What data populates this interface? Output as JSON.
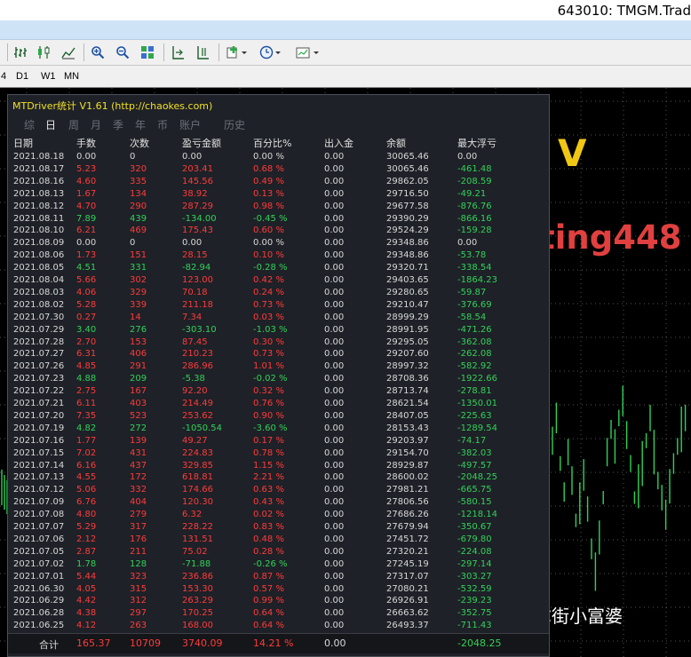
{
  "window": {
    "account_title": "643010: TMGM.Trad"
  },
  "timeframes": [
    "4",
    "D1",
    "W1",
    "MN"
  ],
  "toolbar": {
    "icons": [
      "bar-chart-icon",
      "candle-chart-icon",
      "line-chart-icon",
      "zoom-in-icon",
      "zoom-out-icon",
      "tile-windows-icon",
      "auto-scroll-icon",
      "chart-shift-icon",
      "indicators-icon",
      "periods-icon",
      "templates-icon"
    ]
  },
  "panel": {
    "title": "MTDriver统计 V1.61 (http://chaokes.com)",
    "tabs": [
      "综",
      "日",
      "周",
      "月",
      "季",
      "年",
      "币",
      "账户",
      "历史"
    ],
    "active_tab": "日",
    "columns": [
      "日期",
      "手数",
      "次数",
      "盈亏金额",
      "百分比%",
      "出入金",
      "余额",
      "最大浮亏"
    ],
    "rows": [
      [
        "2021.08.18",
        "0.00",
        "0",
        "0.00",
        "0.00 %",
        "0.00",
        "30065.46",
        "0.00"
      ],
      [
        "2021.08.17",
        "5.23",
        "320",
        "203.41",
        "0.68 %",
        "0.00",
        "30065.46",
        "-461.48"
      ],
      [
        "2021.08.16",
        "4.60",
        "335",
        "145.56",
        "0.49 %",
        "0.00",
        "29862.05",
        "-208.59"
      ],
      [
        "2021.08.13",
        "1.67",
        "134",
        "38.92",
        "0.13 %",
        "0.00",
        "29716.50",
        "-49.21"
      ],
      [
        "2021.08.12",
        "4.70",
        "290",
        "287.29",
        "0.98 %",
        "0.00",
        "29677.58",
        "-876.76"
      ],
      [
        "2021.08.11",
        "7.89",
        "439",
        "-134.00",
        "-0.45 %",
        "0.00",
        "29390.29",
        "-866.16"
      ],
      [
        "2021.08.10",
        "6.21",
        "469",
        "175.43",
        "0.60 %",
        "0.00",
        "29524.29",
        "-159.28"
      ],
      [
        "2021.08.09",
        "0.00",
        "0",
        "0.00",
        "0.00 %",
        "0.00",
        "29348.86",
        "0.00"
      ],
      [
        "2021.08.06",
        "1.73",
        "151",
        "28.15",
        "0.10 %",
        "0.00",
        "29348.86",
        "-53.78"
      ],
      [
        "2021.08.05",
        "4.51",
        "331",
        "-82.94",
        "-0.28 %",
        "0.00",
        "29320.71",
        "-338.54"
      ],
      [
        "2021.08.04",
        "5.66",
        "302",
        "123.00",
        "0.42 %",
        "0.00",
        "29403.65",
        "-1864.23"
      ],
      [
        "2021.08.03",
        "4.06",
        "329",
        "70.18",
        "0.24 %",
        "0.00",
        "29280.65",
        "-59.87"
      ],
      [
        "2021.08.02",
        "5.28",
        "339",
        "211.18",
        "0.73 %",
        "0.00",
        "29210.47",
        "-376.69"
      ],
      [
        "2021.07.30",
        "0.27",
        "14",
        "7.34",
        "0.03 %",
        "0.00",
        "28999.29",
        "-58.54"
      ],
      [
        "2021.07.29",
        "3.40",
        "276",
        "-303.10",
        "-1.03 %",
        "0.00",
        "28991.95",
        "-471.26"
      ],
      [
        "2021.07.28",
        "2.70",
        "153",
        "87.45",
        "0.30 %",
        "0.00",
        "29295.05",
        "-362.08"
      ],
      [
        "2021.07.27",
        "6.31",
        "406",
        "210.23",
        "0.73 %",
        "0.00",
        "29207.60",
        "-262.08"
      ],
      [
        "2021.07.26",
        "4.85",
        "291",
        "286.96",
        "1.01 %",
        "0.00",
        "28997.32",
        "-582.92"
      ],
      [
        "2021.07.23",
        "4.88",
        "209",
        "-5.38",
        "-0.02 %",
        "0.00",
        "28708.36",
        "-1922.66"
      ],
      [
        "2021.07.22",
        "2.75",
        "167",
        "92.20",
        "0.32 %",
        "0.00",
        "28713.74",
        "-278.81"
      ],
      [
        "2021.07.21",
        "6.11",
        "403",
        "214.49",
        "0.76 %",
        "0.00",
        "28621.54",
        "-1350.01"
      ],
      [
        "2021.07.20",
        "7.35",
        "523",
        "253.62",
        "0.90 %",
        "0.00",
        "28407.05",
        "-225.63"
      ],
      [
        "2021.07.19",
        "4.82",
        "272",
        "-1050.54",
        "-3.60 %",
        "0.00",
        "28153.43",
        "-1289.54"
      ],
      [
        "2021.07.16",
        "1.77",
        "139",
        "49.27",
        "0.17 %",
        "0.00",
        "29203.97",
        "-74.17"
      ],
      [
        "2021.07.15",
        "7.02",
        "431",
        "224.83",
        "0.78 %",
        "0.00",
        "29154.70",
        "-382.03"
      ],
      [
        "2021.07.14",
        "6.16",
        "437",
        "329.85",
        "1.15 %",
        "0.00",
        "28929.87",
        "-497.57"
      ],
      [
        "2021.07.13",
        "4.55",
        "172",
        "618.81",
        "2.21 %",
        "0.00",
        "28600.02",
        "-2048.25"
      ],
      [
        "2021.07.12",
        "5.06",
        "332",
        "174.66",
        "0.63 %",
        "0.00",
        "27981.21",
        "-665.75"
      ],
      [
        "2021.07.09",
        "6.76",
        "404",
        "120.30",
        "0.43 %",
        "0.00",
        "27806.56",
        "-580.15"
      ],
      [
        "2021.07.08",
        "4.80",
        "279",
        "6.32",
        "0.02 %",
        "0.00",
        "27686.26",
        "-1218.14"
      ],
      [
        "2021.07.07",
        "5.29",
        "317",
        "228.22",
        "0.83 %",
        "0.00",
        "27679.94",
        "-350.67"
      ],
      [
        "2021.07.06",
        "2.12",
        "176",
        "131.51",
        "0.48 %",
        "0.00",
        "27451.72",
        "-679.80"
      ],
      [
        "2021.07.05",
        "2.87",
        "211",
        "75.02",
        "0.28 %",
        "0.00",
        "27320.21",
        "-224.08"
      ],
      [
        "2021.07.02",
        "1.78",
        "128",
        "-71.88",
        "-0.26 %",
        "0.00",
        "27245.19",
        "-297.14"
      ],
      [
        "2021.07.01",
        "5.44",
        "323",
        "236.86",
        "0.87 %",
        "0.00",
        "27317.07",
        "-303.27"
      ],
      [
        "2021.06.30",
        "4.05",
        "315",
        "153.30",
        "0.57 %",
        "0.00",
        "27080.21",
        "-532.59"
      ],
      [
        "2021.06.29",
        "4.42",
        "312",
        "263.29",
        "0.99 %",
        "0.00",
        "26926.91",
        "-239.23"
      ],
      [
        "2021.06.28",
        "4.38",
        "297",
        "170.25",
        "0.64 %",
        "0.00",
        "26663.62",
        "-352.75"
      ],
      [
        "2021.06.25",
        "4.12",
        "263",
        "168.00",
        "0.64 %",
        "0.00",
        "26493.37",
        "-711.43"
      ]
    ],
    "total": [
      "合计",
      "165.37",
      "10709",
      "3740.09",
      "14.21 %",
      "0.00",
      "",
      "-2048.25"
    ]
  },
  "watermarks": {
    "v_mark": "V",
    "name": "hlting448",
    "bottom_label": "@华尔街小富婆"
  },
  "colors": {
    "profit": "#ff3b3b",
    "loss": "#33d15a",
    "title": "#f2e027",
    "candle": "#2fd15a"
  }
}
